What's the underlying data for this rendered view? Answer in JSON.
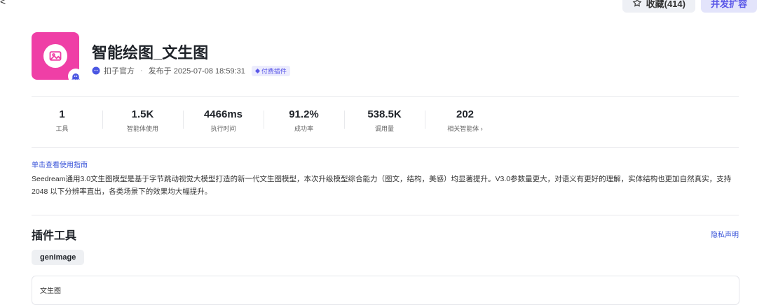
{
  "top_actions": {
    "favorite_label": "收藏(414)",
    "expand_label": "并发扩容"
  },
  "plugin": {
    "title": "智能绘图_文生图",
    "author": "扣子官方",
    "publish_time": "发布于 2025-07-08 18:59:31",
    "paid_tag": "付费插件",
    "icon_color": "#ef3fa6"
  },
  "stats": [
    {
      "value": "1",
      "label": "工具"
    },
    {
      "value": "1.5K",
      "label": "智能体使用"
    },
    {
      "value": "4466ms",
      "label": "执行时间"
    },
    {
      "value": "91.2%",
      "label": "成功率"
    },
    {
      "value": "538.5K",
      "label": "调用量"
    },
    {
      "value": "202",
      "label": "相关智能体 ›"
    }
  ],
  "guide_link": "单击查看使用指南",
  "description": "Seedream通用3.0文生图模型是基于字节跳动视觉大模型打造的新一代文生图模型，本次升级模型综合能力（图文，结构，美感）均显著提升。V3.0参数量更大，对语义有更好的理解，实体结构也更加自然真实，支持 2048 以下分辨率直出，各类场景下的效果均大幅提升。",
  "tools_section": {
    "title": "插件工具",
    "privacy_link": "隐私声明",
    "tool_chip": "genImage",
    "tool_card_name": "文生图"
  }
}
